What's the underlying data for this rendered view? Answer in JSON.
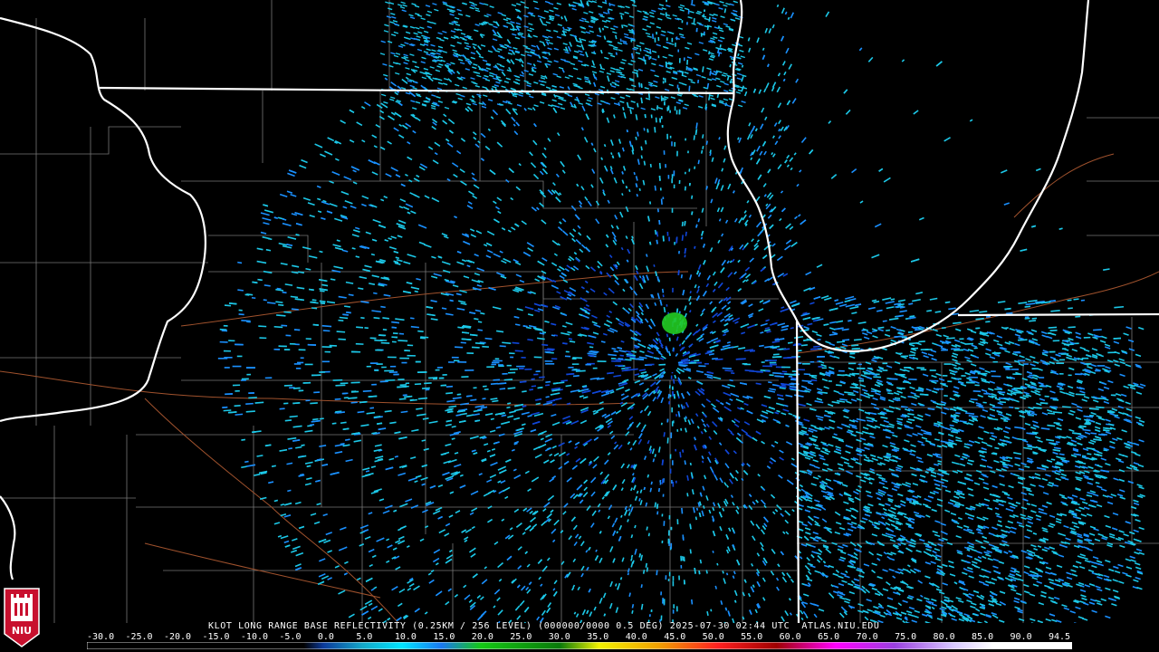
{
  "product": {
    "caption": "KLOT LONG RANGE BASE REFLECTIVITY (0.25KM / 256 LEVEL) (000000/0000 0.5 DEG) 2025-07-30 02:44 UTC  ATLAS.NIU.EDU",
    "radar_site": "KLOT",
    "datetime_utc": "2025-07-30 02:44 UTC",
    "source": "ATLAS.NIU.EDU"
  },
  "logo": {
    "text": "NIU",
    "icon": "niu-castle-logo"
  },
  "scale": {
    "labels": [
      "-30.0",
      "-25.0",
      "-20.0",
      "-15.0",
      "-10.0",
      "-5.0",
      "0.0",
      "5.0",
      "10.0",
      "15.0",
      "20.0",
      "25.0",
      "30.0",
      "35.0",
      "40.0",
      "45.0",
      "50.0",
      "55.0",
      "60.0",
      "65.0",
      "70.0",
      "75.0",
      "80.0",
      "85.0",
      "90.0",
      "94.5"
    ],
    "colors": [
      "#000000",
      "#000000",
      "#000000",
      "#000000",
      "#000000",
      "#000000",
      "#0a3aa0",
      "#1aa6c8",
      "#00e0ff",
      "#1a7cf0",
      "#12c212",
      "#10a010",
      "#0a7a0a",
      "#f0f000",
      "#e8c000",
      "#f09000",
      "#ff2020",
      "#c00000",
      "#900000",
      "#ff00ff",
      "#a040e0",
      "#c0a0ff",
      "#ffffff",
      "#ffffff",
      "#ffffff"
    ]
  },
  "colors": {
    "background": "#000000",
    "state_border": "#ffffff",
    "county_border": "#7a7a7a",
    "road": "#a0522d",
    "echo_light": "#1cc8e8",
    "echo_mid": "#1a90ff",
    "echo_dark": "#1046d8",
    "echo_green": "#22cc22"
  }
}
